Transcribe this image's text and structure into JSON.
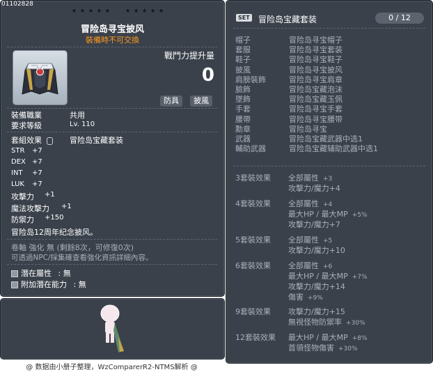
{
  "item_id": "01102828",
  "stars": [
    "★",
    "★",
    "★",
    "★",
    "★",
    "★",
    "★",
    "★",
    "★",
    "★"
  ],
  "item": {
    "name": "冒险岛寻宝披风",
    "trade_note": "裝備時不可交換",
    "power_label": "戰鬥力提升量",
    "power_value": "0",
    "tags": [
      "防具",
      "披風"
    ]
  },
  "requirements": [
    {
      "label": "裝備職業",
      "value": "共用"
    },
    {
      "label": "要求等級",
      "value": "Lv. 110"
    }
  ],
  "set_effect_label": "套組效果",
  "set_effect_name": "冒险岛宝藏套装",
  "stats": [
    {
      "name": "STR",
      "value": "+7"
    },
    {
      "name": "DEX",
      "value": "+7"
    },
    {
      "name": "INT",
      "value": "+7"
    },
    {
      "name": "LUK",
      "value": "+7"
    },
    {
      "name": "攻擊力",
      "value": "+1"
    },
    {
      "name": "魔法攻擊力",
      "value": "+1"
    },
    {
      "name": "防禦力",
      "value": "+150"
    }
  ],
  "description": "冒险岛12周年纪念披风。",
  "scroll_line": "卷軸 強化 無 (剩餘8次，可修復0次)",
  "npc_line": "可透過NPC/採集確查看強化資訊詳細內容。",
  "potential": [
    {
      "label": "潛在屬性",
      "value": ": 無"
    },
    {
      "label": "附加潛在能力",
      "value": ": 無"
    }
  ],
  "set": {
    "badge": "SET",
    "name": "冒险岛宝藏套装",
    "count": "0 / 12",
    "parts": [
      {
        "slot": "帽子",
        "item": "冒险岛寻宝帽子"
      },
      {
        "slot": "套服",
        "item": "冒险岛寻宝套装"
      },
      {
        "slot": "鞋子",
        "item": "冒险岛寻宝鞋子"
      },
      {
        "slot": "披風",
        "item": "冒险岛寻宝披风"
      },
      {
        "slot": "肩膀裝飾",
        "item": "冒险岛寻宝肩章"
      },
      {
        "slot": "臉飾",
        "item": "冒险岛宝藏泡沫"
      },
      {
        "slot": "墜飾",
        "item": "冒险岛宝藏玉佩"
      },
      {
        "slot": "手套",
        "item": "冒险岛寻宝手套"
      },
      {
        "slot": "腰帶",
        "item": "冒险岛寻宝腰带"
      },
      {
        "slot": "勳章",
        "item": "冒险岛寻宝"
      },
      {
        "slot": "武器",
        "item": "冒险岛宝藏武器中选1"
      },
      {
        "slot": "輔助武器",
        "item": "冒险岛宝藏辅助武器中选1"
      }
    ],
    "effects": [
      {
        "label": "3套裝效果",
        "lines": [
          {
            "text": "全部屬性",
            "value": "+3"
          },
          {
            "text": "攻擊力/魔力+4",
            "value": ""
          }
        ]
      },
      {
        "label": "4套裝效果",
        "lines": [
          {
            "text": "全部屬性",
            "value": "+4"
          },
          {
            "text": "最大HP / 最大MP",
            "value": "+5%"
          },
          {
            "text": "攻擊力/魔力+7",
            "value": ""
          }
        ]
      },
      {
        "label": "5套裝效果",
        "lines": [
          {
            "text": "全部屬性",
            "value": "+5"
          },
          {
            "text": "攻擊力/魔力+10",
            "value": ""
          }
        ]
      },
      {
        "label": "6套裝效果",
        "lines": [
          {
            "text": "全部屬性",
            "value": "+6"
          },
          {
            "text": "最大HP / 最大MP",
            "value": "+7%"
          },
          {
            "text": "攻擊力/魔力+14",
            "value": ""
          },
          {
            "text": "傷害",
            "value": "+9%"
          }
        ]
      },
      {
        "label": "9套裝效果",
        "lines": [
          {
            "text": "攻擊力/魔力+15",
            "value": ""
          },
          {
            "text": "無視怪物防禦率",
            "value": "+30%"
          }
        ]
      },
      {
        "label": "12套裝效果",
        "lines": [
          {
            "text": "最大HP / 最大MP",
            "value": "+8%"
          },
          {
            "text": "首領怪物傷害",
            "value": "+30%"
          }
        ]
      }
    ]
  },
  "footer": "@ 数据由小册子整理，WzComparerR2-NTMS解析 @"
}
